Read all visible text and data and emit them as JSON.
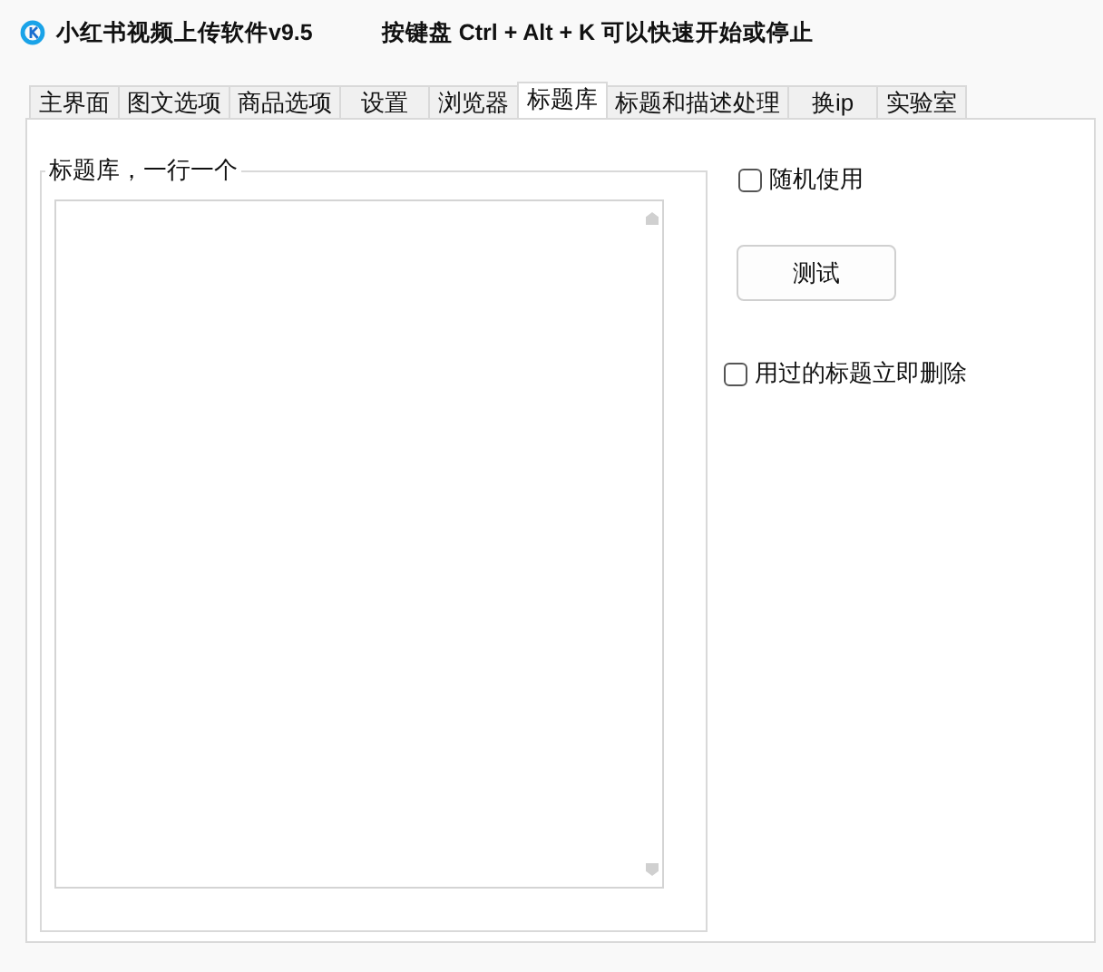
{
  "window": {
    "title": "小红书视频上传软件v9.5",
    "hint": "按键盘 Ctrl + Alt + K  可以快速开始或停止"
  },
  "tabs": [
    {
      "label": "主界面",
      "selected": false
    },
    {
      "label": "图文选项",
      "selected": false
    },
    {
      "label": "商品选项",
      "selected": false
    },
    {
      "label": "设置",
      "selected": false
    },
    {
      "label": "浏览器",
      "selected": false
    },
    {
      "label": "标题库",
      "selected": true
    },
    {
      "label": "标题和描述处理",
      "selected": false
    },
    {
      "label": "换ip",
      "selected": false
    },
    {
      "label": "实验室",
      "selected": false
    }
  ],
  "title_library": {
    "group_label": "标题库，一行一个"
  },
  "options": [
    {
      "kind": "checkbox",
      "label": "随机使用",
      "checked": false
    },
    {
      "kind": "button",
      "label": "测试"
    },
    {
      "kind": "checkbox",
      "label": "用过的标题立即删除",
      "checked": false
    }
  ]
}
